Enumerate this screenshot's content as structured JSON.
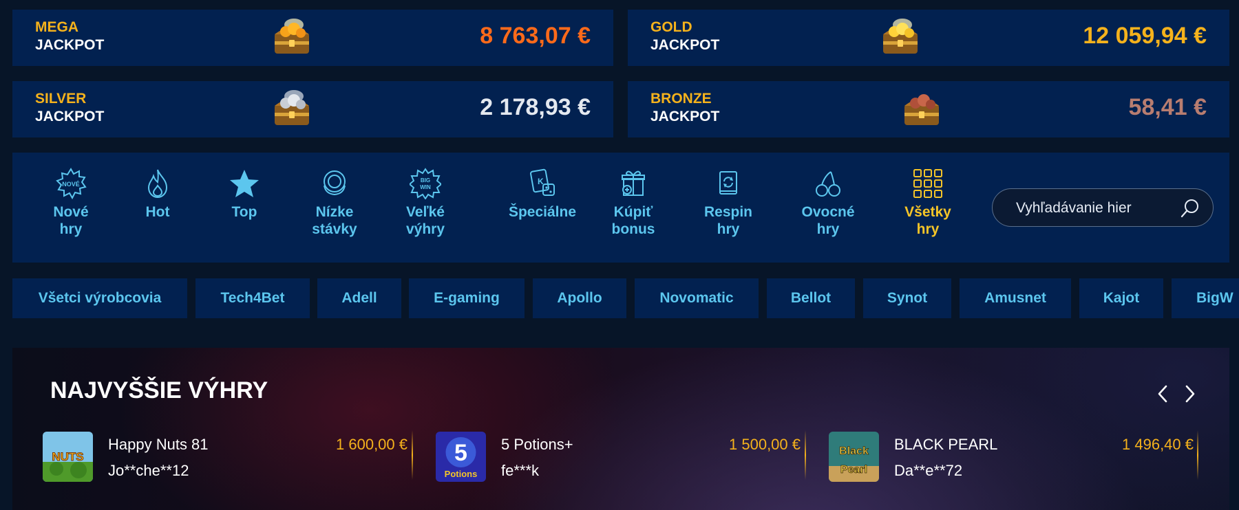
{
  "jackpots": [
    {
      "tier": "MEGA",
      "word": "JACKPOT",
      "amount": "8 763,07 €",
      "tier_color": "#f5b21c",
      "amount_color": "#ff6a1a",
      "icon": "gold-chest-icon"
    },
    {
      "tier": "GOLD",
      "word": "JACKPOT",
      "amount": "12 059,94 €",
      "tier_color": "#f5b21c",
      "amount_color": "#f5b21c",
      "icon": "gold-chest-icon"
    },
    {
      "tier": "SILVER",
      "word": "JACKPOT",
      "amount": "2 178,93 €",
      "tier_color": "#f5b21c",
      "amount_color": "#e4e9f0",
      "icon": "silver-chest-icon"
    },
    {
      "tier": "BRONZE",
      "word": "JACKPOT",
      "amount": "58,41 €",
      "tier_color": "#f5b21c",
      "amount_color": "#b87d70",
      "icon": "bronze-chest-icon"
    }
  ],
  "categories": [
    {
      "line1": "Nové",
      "line2": "hry",
      "icon": "new-badge-icon",
      "badge_text": "NOVÉ"
    },
    {
      "line1": "Hot",
      "line2": "",
      "icon": "flame-icon"
    },
    {
      "line1": "Top",
      "line2": "",
      "icon": "star-icon"
    },
    {
      "line1": "Nízke",
      "line2": "stávky",
      "icon": "chips-icon"
    },
    {
      "line1": "Veľké",
      "line2": "výhry",
      "icon": "big-win-icon",
      "badge_text": "BIG WIN"
    },
    {
      "line1": "Špeciálne",
      "line2": "",
      "icon": "cards-dice-icon"
    },
    {
      "line1": "Kúpiť",
      "line2": "bonus",
      "icon": "gift-plus-icon"
    },
    {
      "line1": "Respin",
      "line2": "hry",
      "icon": "respin-icon"
    },
    {
      "line1": "Ovocné",
      "line2": "hry",
      "icon": "cherries-icon"
    },
    {
      "line1": "Všetky",
      "line2": "hry",
      "icon": "grid-icon",
      "active": true
    }
  ],
  "search": {
    "placeholder": "Vyhľadávanie hier",
    "icon": "search-icon"
  },
  "providers": [
    "Všetci výrobcovia",
    "Tech4Bet",
    "Adell",
    "E-gaming",
    "Apollo",
    "Novomatic",
    "Bellot",
    "Synot",
    "Amusnet",
    "Kajot",
    "BigW"
  ],
  "top_wins": {
    "title": "NAJVYŠŠIE VÝHRY",
    "items": [
      {
        "game": "Happy Nuts 81",
        "user": "Jo**che**12",
        "amount": "1 600,00 €",
        "thumb_text": "NUTS"
      },
      {
        "game": "5 Potions+",
        "user": "fe***k",
        "amount": "1 500,00 €",
        "thumb_text": "5 Potions"
      },
      {
        "game": "BLACK PEARL",
        "user": "Da**e**72",
        "amount": "1 496,40 €",
        "thumb_text": "Black Pearl"
      }
    ]
  },
  "colors": {
    "page_bg": "#071528",
    "panel_bg": "#022150",
    "accent_cyan": "#5cc6ee",
    "accent_yellow": "#f5c528",
    "win_amount": "#f5b21c"
  }
}
